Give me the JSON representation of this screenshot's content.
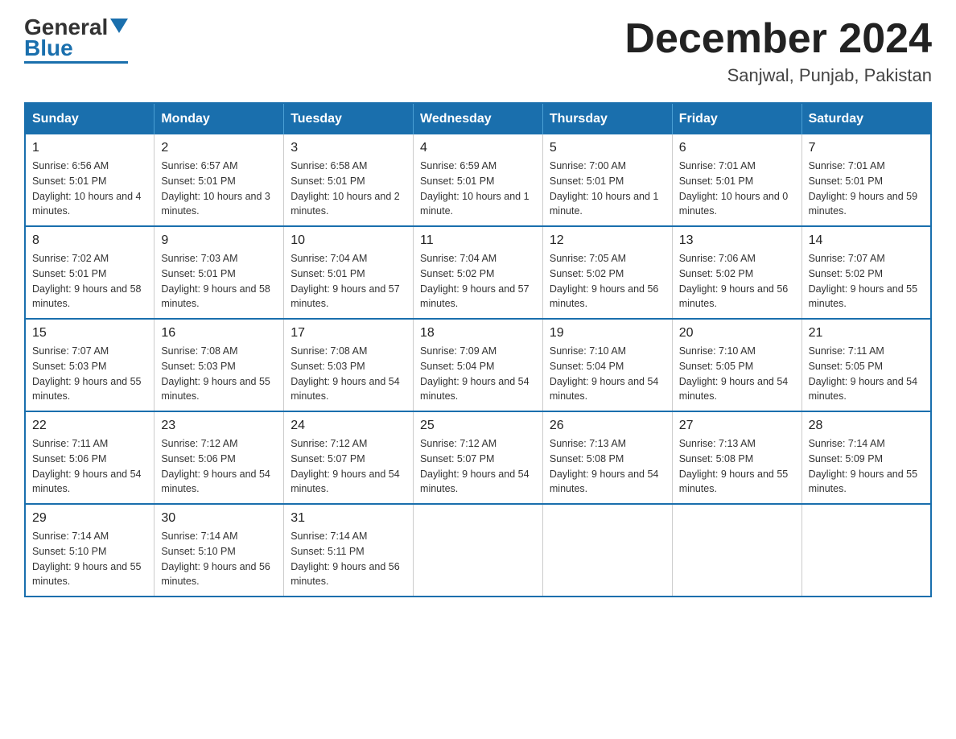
{
  "header": {
    "logo_general": "General",
    "logo_blue": "Blue",
    "month_title": "December 2024",
    "location": "Sanjwal, Punjab, Pakistan"
  },
  "days_of_week": [
    "Sunday",
    "Monday",
    "Tuesday",
    "Wednesday",
    "Thursday",
    "Friday",
    "Saturday"
  ],
  "weeks": [
    [
      {
        "day": "1",
        "sunrise": "6:56 AM",
        "sunset": "5:01 PM",
        "daylight": "10 hours and 4 minutes."
      },
      {
        "day": "2",
        "sunrise": "6:57 AM",
        "sunset": "5:01 PM",
        "daylight": "10 hours and 3 minutes."
      },
      {
        "day": "3",
        "sunrise": "6:58 AM",
        "sunset": "5:01 PM",
        "daylight": "10 hours and 2 minutes."
      },
      {
        "day": "4",
        "sunrise": "6:59 AM",
        "sunset": "5:01 PM",
        "daylight": "10 hours and 1 minute."
      },
      {
        "day": "5",
        "sunrise": "7:00 AM",
        "sunset": "5:01 PM",
        "daylight": "10 hours and 1 minute."
      },
      {
        "day": "6",
        "sunrise": "7:01 AM",
        "sunset": "5:01 PM",
        "daylight": "10 hours and 0 minutes."
      },
      {
        "day": "7",
        "sunrise": "7:01 AM",
        "sunset": "5:01 PM",
        "daylight": "9 hours and 59 minutes."
      }
    ],
    [
      {
        "day": "8",
        "sunrise": "7:02 AM",
        "sunset": "5:01 PM",
        "daylight": "9 hours and 58 minutes."
      },
      {
        "day": "9",
        "sunrise": "7:03 AM",
        "sunset": "5:01 PM",
        "daylight": "9 hours and 58 minutes."
      },
      {
        "day": "10",
        "sunrise": "7:04 AM",
        "sunset": "5:01 PM",
        "daylight": "9 hours and 57 minutes."
      },
      {
        "day": "11",
        "sunrise": "7:04 AM",
        "sunset": "5:02 PM",
        "daylight": "9 hours and 57 minutes."
      },
      {
        "day": "12",
        "sunrise": "7:05 AM",
        "sunset": "5:02 PM",
        "daylight": "9 hours and 56 minutes."
      },
      {
        "day": "13",
        "sunrise": "7:06 AM",
        "sunset": "5:02 PM",
        "daylight": "9 hours and 56 minutes."
      },
      {
        "day": "14",
        "sunrise": "7:07 AM",
        "sunset": "5:02 PM",
        "daylight": "9 hours and 55 minutes."
      }
    ],
    [
      {
        "day": "15",
        "sunrise": "7:07 AM",
        "sunset": "5:03 PM",
        "daylight": "9 hours and 55 minutes."
      },
      {
        "day": "16",
        "sunrise": "7:08 AM",
        "sunset": "5:03 PM",
        "daylight": "9 hours and 55 minutes."
      },
      {
        "day": "17",
        "sunrise": "7:08 AM",
        "sunset": "5:03 PM",
        "daylight": "9 hours and 54 minutes."
      },
      {
        "day": "18",
        "sunrise": "7:09 AM",
        "sunset": "5:04 PM",
        "daylight": "9 hours and 54 minutes."
      },
      {
        "day": "19",
        "sunrise": "7:10 AM",
        "sunset": "5:04 PM",
        "daylight": "9 hours and 54 minutes."
      },
      {
        "day": "20",
        "sunrise": "7:10 AM",
        "sunset": "5:05 PM",
        "daylight": "9 hours and 54 minutes."
      },
      {
        "day": "21",
        "sunrise": "7:11 AM",
        "sunset": "5:05 PM",
        "daylight": "9 hours and 54 minutes."
      }
    ],
    [
      {
        "day": "22",
        "sunrise": "7:11 AM",
        "sunset": "5:06 PM",
        "daylight": "9 hours and 54 minutes."
      },
      {
        "day": "23",
        "sunrise": "7:12 AM",
        "sunset": "5:06 PM",
        "daylight": "9 hours and 54 minutes."
      },
      {
        "day": "24",
        "sunrise": "7:12 AM",
        "sunset": "5:07 PM",
        "daylight": "9 hours and 54 minutes."
      },
      {
        "day": "25",
        "sunrise": "7:12 AM",
        "sunset": "5:07 PM",
        "daylight": "9 hours and 54 minutes."
      },
      {
        "day": "26",
        "sunrise": "7:13 AM",
        "sunset": "5:08 PM",
        "daylight": "9 hours and 54 minutes."
      },
      {
        "day": "27",
        "sunrise": "7:13 AM",
        "sunset": "5:08 PM",
        "daylight": "9 hours and 55 minutes."
      },
      {
        "day": "28",
        "sunrise": "7:14 AM",
        "sunset": "5:09 PM",
        "daylight": "9 hours and 55 minutes."
      }
    ],
    [
      {
        "day": "29",
        "sunrise": "7:14 AM",
        "sunset": "5:10 PM",
        "daylight": "9 hours and 55 minutes."
      },
      {
        "day": "30",
        "sunrise": "7:14 AM",
        "sunset": "5:10 PM",
        "daylight": "9 hours and 56 minutes."
      },
      {
        "day": "31",
        "sunrise": "7:14 AM",
        "sunset": "5:11 PM",
        "daylight": "9 hours and 56 minutes."
      },
      null,
      null,
      null,
      null
    ]
  ]
}
